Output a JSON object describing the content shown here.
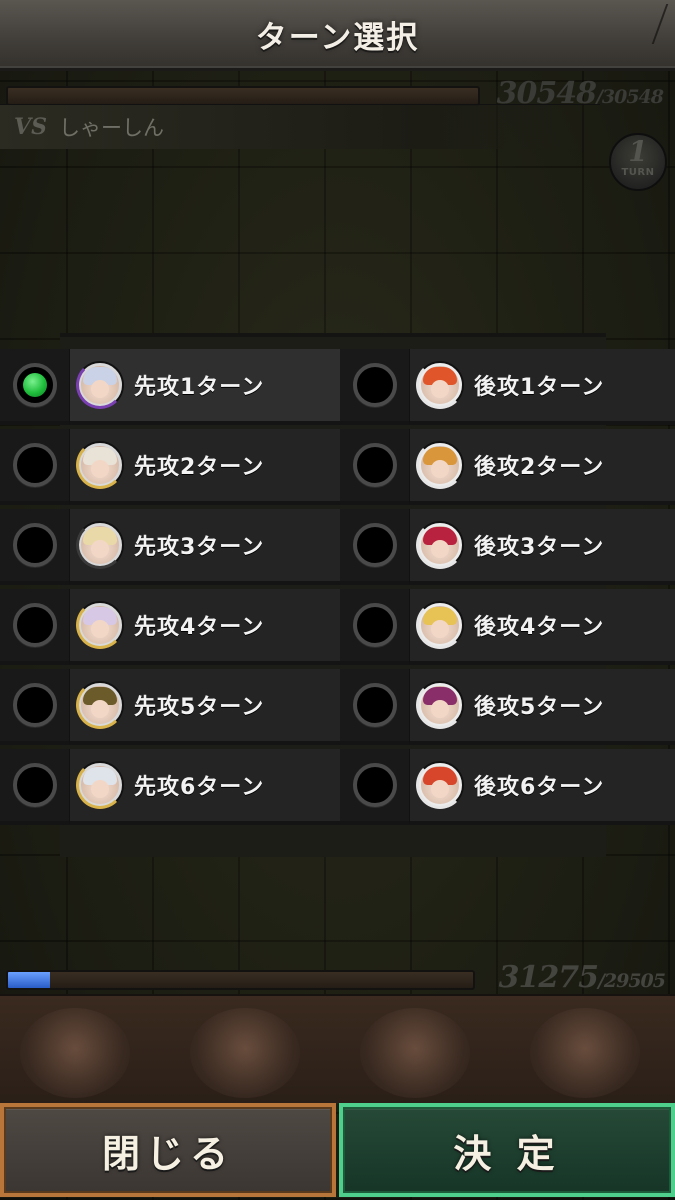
{
  "header": {
    "title": "ターン選択"
  },
  "enemy": {
    "vs": "VS",
    "name": "しゃーしん",
    "hp_current": "30548",
    "hp_max": "/30548"
  },
  "turn_indicator": {
    "number": "1",
    "word": "TURN"
  },
  "options": [
    {
      "first": {
        "label": "先攻1ターン",
        "selected": true,
        "hair": "#c9d2e6",
        "ring": "#7a3fb0"
      },
      "second": {
        "label": "後攻1ターン",
        "selected": false,
        "hair": "#e0562a",
        "ring": "#e6e6e6"
      }
    },
    {
      "first": {
        "label": "先攻2ターン",
        "selected": false,
        "hair": "#e9e2d6",
        "ring": "#d8b24a"
      },
      "second": {
        "label": "後攻2ターン",
        "selected": false,
        "hair": "#d9963a",
        "ring": "#e6e6e6"
      }
    },
    {
      "first": {
        "label": "先攻3ターン",
        "selected": false,
        "hair": "#ead9a8",
        "ring": "#3a3a3a"
      },
      "second": {
        "label": "後攻3ターン",
        "selected": false,
        "hair": "#b8223e",
        "ring": "#e6e6e6"
      }
    },
    {
      "first": {
        "label": "先攻4ターン",
        "selected": false,
        "hair": "#d7c9e6",
        "ring": "#d8b24a"
      },
      "second": {
        "label": "後攻4ターン",
        "selected": false,
        "hair": "#e7c255",
        "ring": "#e6e6e6"
      }
    },
    {
      "first": {
        "label": "先攻5ターン",
        "selected": false,
        "hair": "#6b5a2a",
        "ring": "#d8b24a"
      },
      "second": {
        "label": "後攻5ターン",
        "selected": false,
        "hair": "#8a2e6a",
        "ring": "#e6e6e6"
      }
    },
    {
      "first": {
        "label": "先攻6ターン",
        "selected": false,
        "hair": "#dfe3ea",
        "ring": "#d8b24a"
      },
      "second": {
        "label": "後攻6ターン",
        "selected": false,
        "hair": "#d7462a",
        "ring": "#e6e6e6"
      }
    }
  ],
  "player": {
    "hp_current": "31275",
    "hp_max": "/29505",
    "hp_fill_fraction": 0.09
  },
  "buttons": {
    "close": "閉じる",
    "confirm": "決 定"
  },
  "colors": {
    "selected_radio": "#1fbe3c",
    "close_border": "#b8763a",
    "confirm_border": "#4fcf8c"
  }
}
